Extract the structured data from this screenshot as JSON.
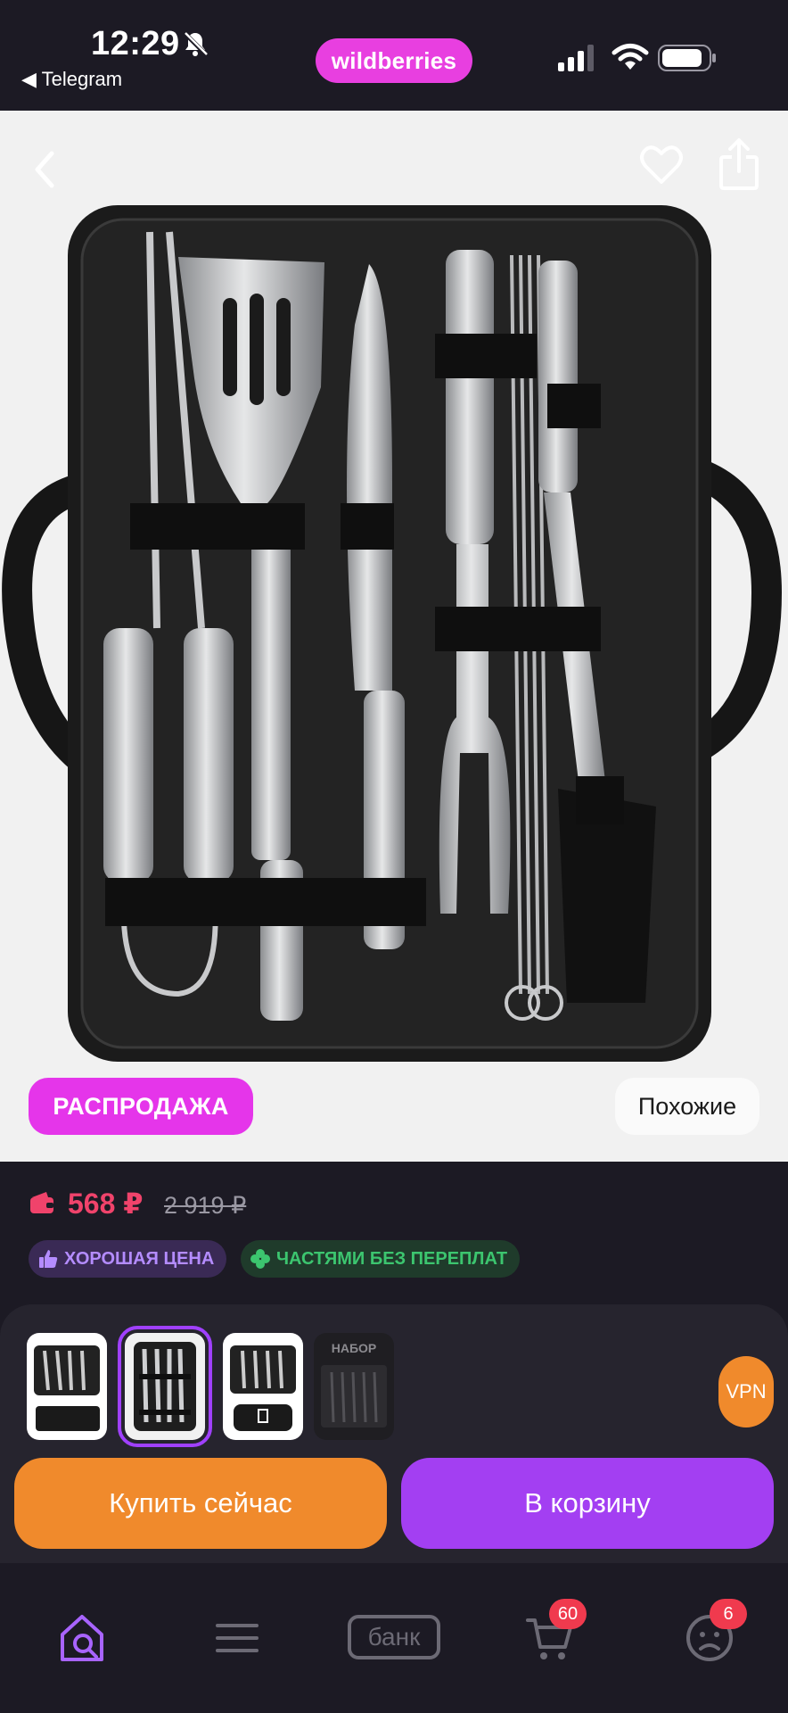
{
  "status_bar": {
    "time": "12:29",
    "back_app": "◀ Telegram",
    "brand": "wildberries"
  },
  "gallery": {
    "sale_badge": "РАСПРОДАЖА",
    "similar_button": "Похожие"
  },
  "price": {
    "current": "568 ₽",
    "old": "2 919 ₽",
    "tags": [
      {
        "label": "ХОРОШАЯ ЦЕНА"
      },
      {
        "label": "ЧАСТЯМИ БЕЗ ПЕРЕПЛАТ"
      }
    ]
  },
  "sheet": {
    "thumbnail_texts": [
      "НАБОР"
    ],
    "vpn": "VPN",
    "buy_now": "Купить сейчас",
    "add_to_cart": "В корзину"
  },
  "tabbar": {
    "bank_label": "банк",
    "cart_badge": "60",
    "profile_badge": "6"
  },
  "colors": {
    "brand": "#e83fe0",
    "price": "#f0436b",
    "buy": "#f08a2c",
    "cart": "#a33ff2"
  }
}
